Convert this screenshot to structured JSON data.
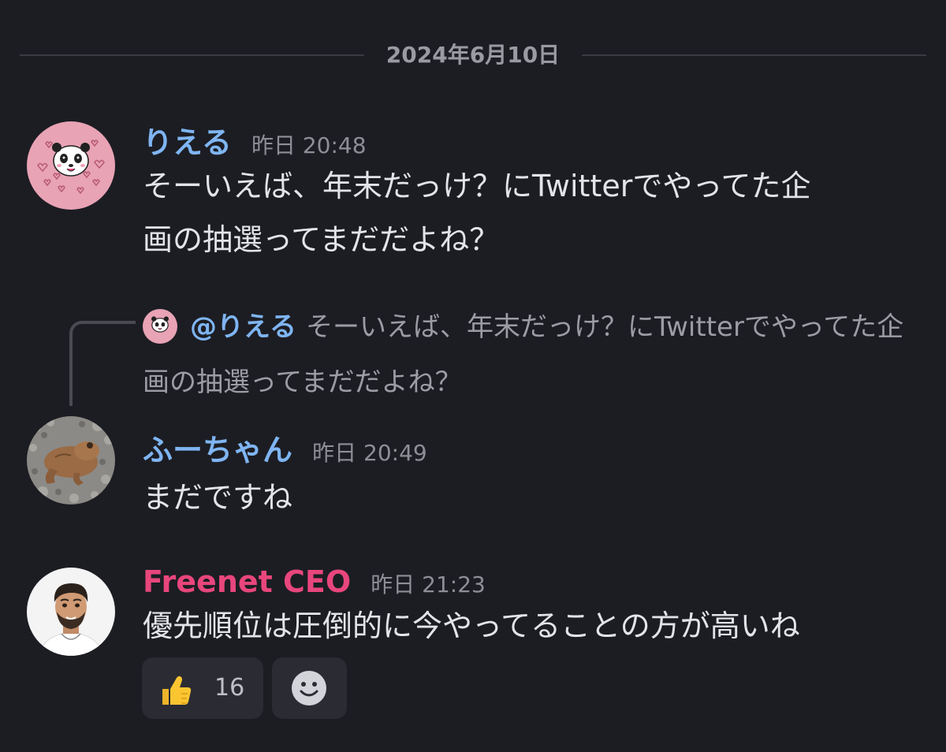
{
  "date_divider": "2024年6月10日",
  "messages": [
    {
      "username": "りえる",
      "username_color": "#7fb5f2",
      "timestamp": "昨日 20:48",
      "lines": [
        "そーいえば、年末だっけ？にTwitterでやってた企",
        "画の抽選ってまだだよね？"
      ],
      "avatar": "panda-avatar"
    },
    {
      "reply": {
        "mention": "@りえる",
        "text": "そーいえば、年末だっけ？にTwitterでやってた企画の抽選ってまだだよね？"
      },
      "username": "ふーちゃん",
      "username_color": "#7fb5f2",
      "timestamp": "昨日 20:49",
      "lines": [
        "まだですね"
      ],
      "avatar": "frog-avatar"
    },
    {
      "username": "Freenet CEO",
      "username_color": "#e8467c",
      "timestamp": "昨日 21:23",
      "lines": [
        "優先順位は圧倒的に今やってることの方が高いね"
      ],
      "avatar": "man-avatar",
      "reactions": [
        {
          "emoji": "thumbs-up",
          "count": "16"
        }
      ]
    }
  ]
}
